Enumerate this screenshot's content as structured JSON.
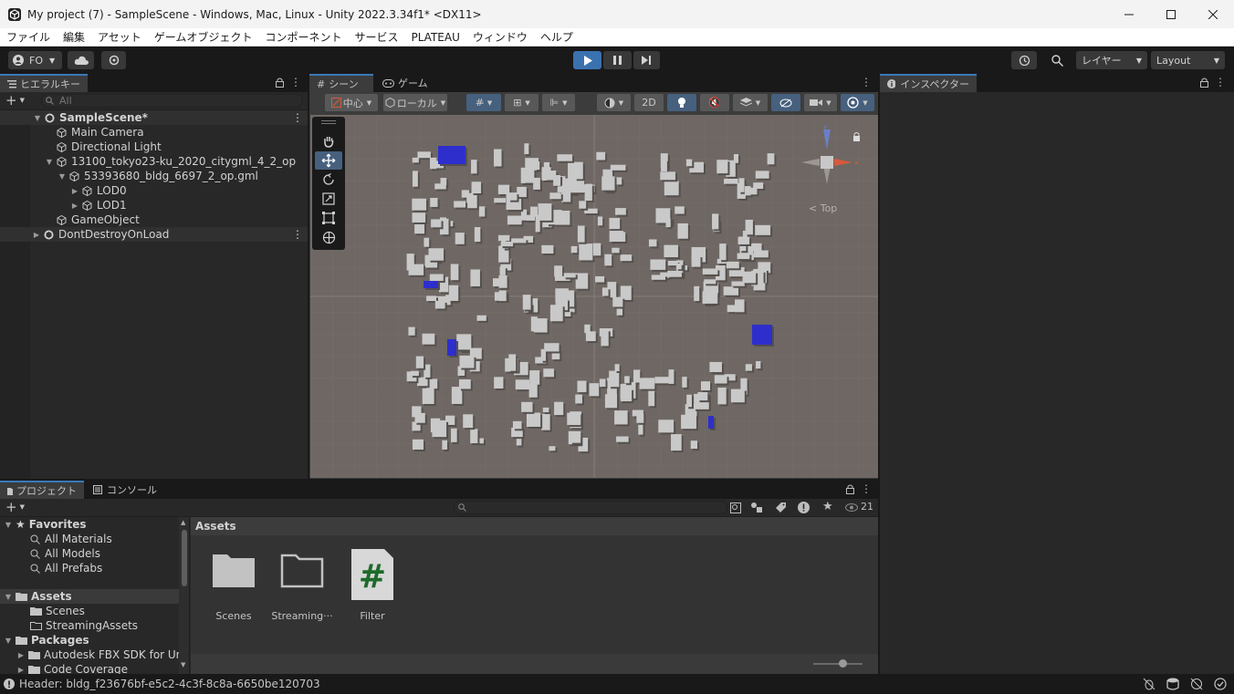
{
  "window": {
    "title": "My project (7) - SampleScene - Windows, Mac, Linux - Unity 2022.3.34f1* <DX11>"
  },
  "menu": [
    "ファイル",
    "編集",
    "アセット",
    "ゲームオブジェクト",
    "コンポーネント",
    "サービス",
    "PLATEAU",
    "ウィンドウ",
    "ヘルプ"
  ],
  "toolbar": {
    "account": "FO",
    "layers": "レイヤー",
    "layout": "Layout"
  },
  "hierarchy": {
    "tab": "ヒエラルキー",
    "search_placeholder": "All",
    "items": [
      {
        "label": "SampleScene*"
      },
      {
        "label": "Main Camera"
      },
      {
        "label": "Directional Light"
      },
      {
        "label": "13100_tokyo23-ku_2020_citygml_4_2_op"
      },
      {
        "label": "53393680_bldg_6697_2_op.gml"
      },
      {
        "label": "LOD0"
      },
      {
        "label": "LOD1"
      },
      {
        "label": "GameObject"
      },
      {
        "label": "DontDestroyOnLoad"
      }
    ]
  },
  "scene": {
    "tabs": [
      "シーン",
      "ゲーム"
    ],
    "pivot": "中心",
    "space": "ローカル",
    "mode2d": "2D",
    "gizmo_label": "< Top"
  },
  "inspector": {
    "tab": "インスペクター"
  },
  "project": {
    "tabs": [
      "プロジェクト",
      "コンソール"
    ],
    "hidden_count": "21",
    "favorites_label": "Favorites",
    "favorites": [
      "All Materials",
      "All Models",
      "All Prefabs"
    ],
    "assets_label": "Assets",
    "assets_children": [
      "Scenes",
      "StreamingAssets"
    ],
    "packages_label": "Packages",
    "packages_children": [
      "Autodesk FBX SDK for Unity",
      "Code Coverage"
    ],
    "breadcrumb": "Assets",
    "grid_items": [
      {
        "label": "Scenes",
        "type": "folder"
      },
      {
        "label": "Streaming···",
        "type": "folder-empty"
      },
      {
        "label": "Filter",
        "type": "script"
      }
    ]
  },
  "status": {
    "message": "Header: bldg_f23676bf-e5c2-4c3f-8c8a-6650be120703"
  },
  "colors": {
    "accent": "#3a79bb",
    "scene_bg": "#6e6763",
    "building": "#c9c9c9",
    "highlight": "#2e2ecc"
  }
}
